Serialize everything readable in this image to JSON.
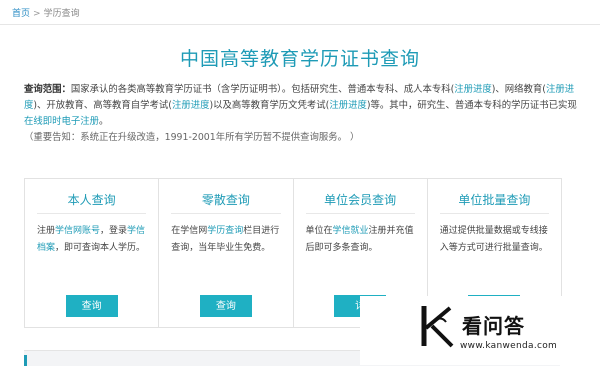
{
  "breadcrumb": {
    "home": "首页",
    "separator": ">",
    "current": "学历查询"
  },
  "page_title": "中国高等教育学历证书查询",
  "description": {
    "label": "查询范围：",
    "p1": "国家承认的各类高等教育学历证书（含学历证明书）。包括研究生、普通本专科、成人本专科(",
    "link1": "注册进度",
    "p2": ")、网络教育(",
    "link2": "注册进度",
    "p3": ")、开放教育、高等教育自学考试(",
    "link3": "注册进度",
    "p4": ")以及高等教育学历文凭考试(",
    "link4": "注册进度",
    "p5": ")等。其中，研究生、普通本专科的学历证书已实现",
    "link5": "在线即时电子注册",
    "p6": "。",
    "notice": "（重要告知：系统正在升级改造，1991-2001年所有学历暂不提供查询服务。 ）"
  },
  "cards": [
    {
      "title": "本人查询",
      "t1": "注册",
      "l1": "学信网账号",
      "t2": "，登录",
      "l2": "学信档案",
      "t3": "，即可查询本人学历。",
      "button": "查询"
    },
    {
      "title": "零散查询",
      "t1": "在学信网",
      "l1": "学历查询",
      "t2": "栏目进行查询，当年毕业生免费。",
      "button": "查询"
    },
    {
      "title": "单位会员查询",
      "t1": "单位在",
      "l1": "学信就业",
      "t2": "注册并充值后即可多条查询。",
      "button": "详"
    },
    {
      "title": "单位批量查询",
      "t1": "通过提供批量数据或专线接入等方式可进行批量查询。"
    }
  ],
  "watermark": {
    "text": "看问答",
    "url": "www.kanwenda.com"
  },
  "colors": {
    "accent": "#1e9bb6",
    "button": "#1fb0c3"
  }
}
